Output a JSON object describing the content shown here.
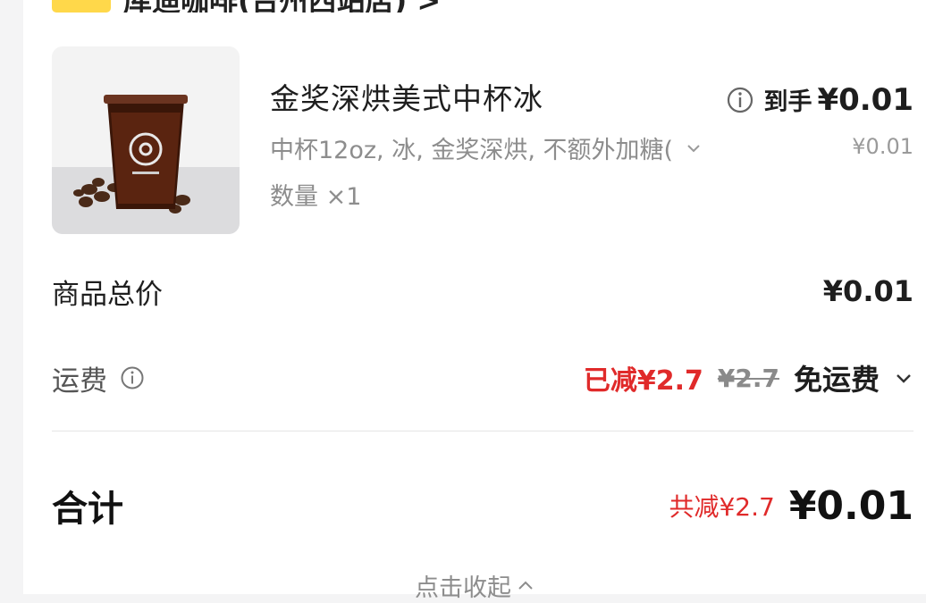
{
  "shop": {
    "name": "库迪咖啡(台州西站店) >"
  },
  "product": {
    "name": "金奖深烘美式中杯冰",
    "spec": "中杯12oz, 冰, 金奖深烘, 不额外加糖(",
    "qty": "数量 ×1",
    "arrive_label": "到手",
    "arrive_price": "¥0.01",
    "orig_price": "¥0.01"
  },
  "subtotal": {
    "label": "商品总价",
    "value": "¥0.01"
  },
  "shipping": {
    "label": "运费",
    "reduced": "已减¥2.7",
    "original": "¥2.7",
    "status": "免运费"
  },
  "total": {
    "label": "合计",
    "reduced": "共减¥2.7",
    "value": "¥0.01"
  },
  "collapse": {
    "label": "点击收起"
  },
  "colors": {
    "accent_red": "#e02a2a",
    "tag_yellow": "#ffd84a"
  }
}
